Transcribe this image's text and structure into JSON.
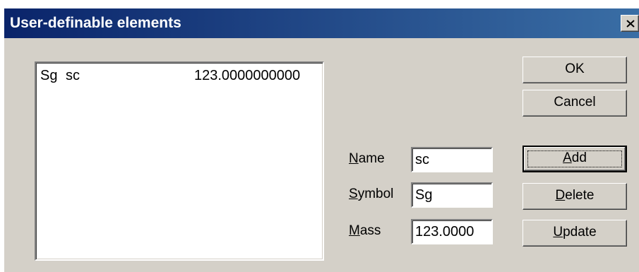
{
  "window": {
    "title": "User-definable elements"
  },
  "list": {
    "items": [
      {
        "symbol": "Sg",
        "name": "sc",
        "mass": "123.0000000000"
      }
    ]
  },
  "fields": {
    "name": {
      "label_ul": "N",
      "label_rest": "ame",
      "value": "sc"
    },
    "symbol": {
      "label_ul": "S",
      "label_rest": "ymbol",
      "value": "Sg"
    },
    "mass": {
      "label_ul": "M",
      "label_rest": "ass",
      "value": "123.0000"
    }
  },
  "buttons": {
    "ok": {
      "label": "OK"
    },
    "cancel": {
      "label": "Cancel"
    },
    "add": {
      "label_pre": "",
      "label_ul": "A",
      "label_rest": "dd"
    },
    "delete": {
      "label_pre": "",
      "label_ul": "D",
      "label_rest": "elete"
    },
    "update": {
      "label_pre": "",
      "label_ul": "U",
      "label_rest": "pdate"
    }
  },
  "icons": {
    "close": "close-icon"
  },
  "colors": {
    "titlebar_start": "#0a246a",
    "titlebar_end": "#3a6ea5",
    "dialog_face": "#d4d0c8"
  }
}
